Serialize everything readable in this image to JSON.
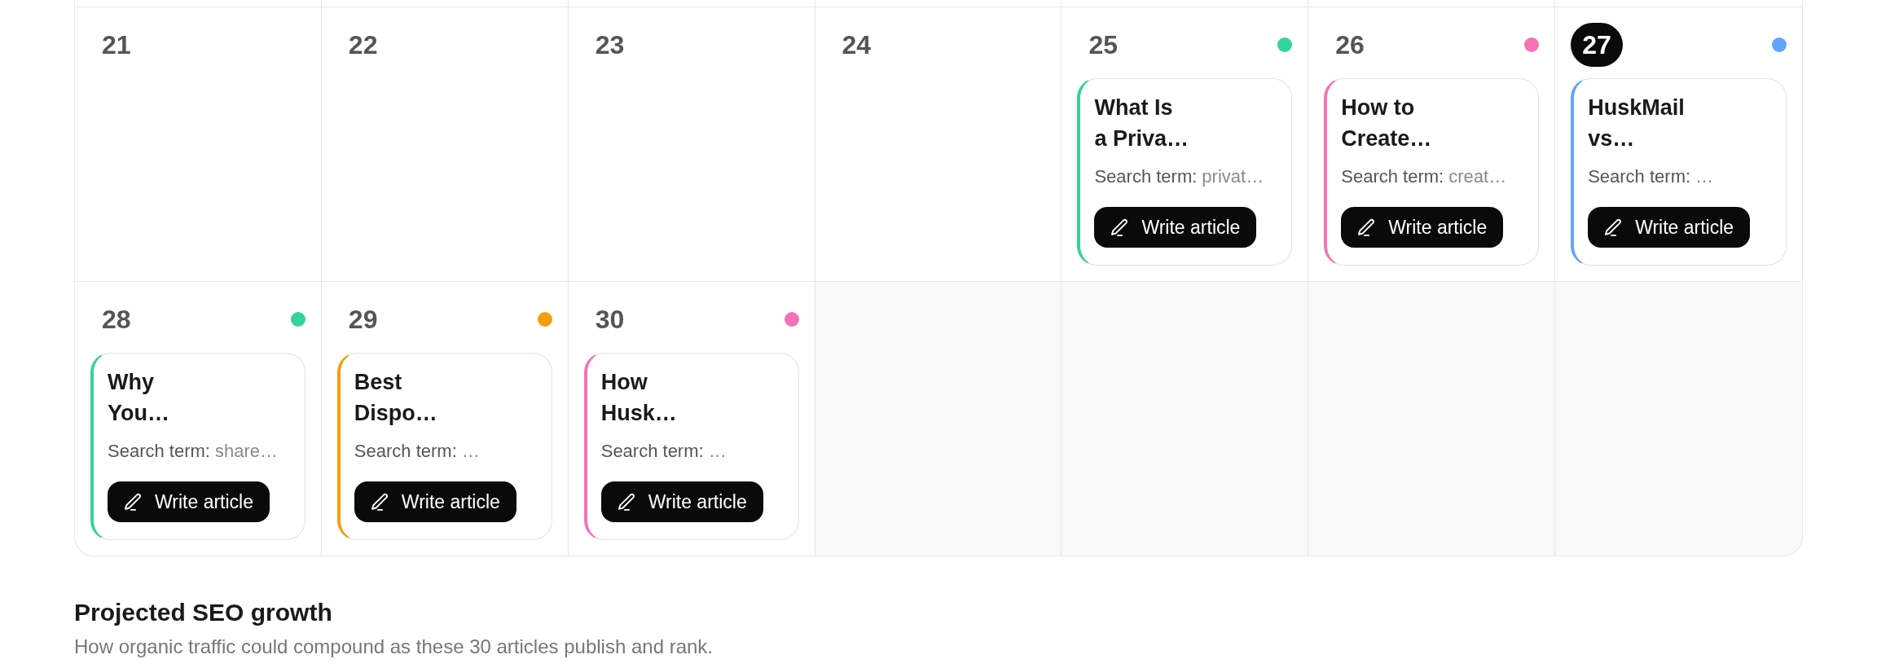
{
  "calendar": {
    "weeks": [
      {
        "days": [
          {
            "kind": "day",
            "number": "21",
            "today": false
          },
          {
            "kind": "day",
            "number": "22",
            "today": false
          },
          {
            "kind": "day",
            "number": "23",
            "today": false
          },
          {
            "kind": "day",
            "number": "24",
            "today": false
          },
          {
            "kind": "day",
            "number": "25",
            "today": false,
            "color": "#34d399",
            "article": {
              "title": "What Is\na Priva…",
              "search_label": "Search term:",
              "search_term": "privat…",
              "button": "Write article"
            }
          },
          {
            "kind": "day",
            "number": "26",
            "today": false,
            "color": "#f472b6",
            "article": {
              "title": "How to\nCreate…",
              "search_label": "Search term:",
              "search_term": "creat…",
              "button": "Write article"
            }
          },
          {
            "kind": "day",
            "number": "27",
            "today": true,
            "color": "#60a5fa",
            "article": {
              "title": "HuskMail\nvs…",
              "search_label": "Search term:",
              "search_term": "…",
              "button": "Write article"
            }
          }
        ]
      },
      {
        "days": [
          {
            "kind": "day",
            "number": "28",
            "today": false,
            "color": "#34d399",
            "article": {
              "title": "Why\nYou…",
              "search_label": "Search term:",
              "search_term": "share…",
              "button": "Write article"
            }
          },
          {
            "kind": "day",
            "number": "29",
            "today": false,
            "color": "#f59e0b",
            "article": {
              "title": "Best\nDispo…",
              "search_label": "Search term:",
              "search_term": "…",
              "button": "Write article"
            }
          },
          {
            "kind": "day",
            "number": "30",
            "today": false,
            "color": "#f472b6",
            "article": {
              "title": "How\nHusk…",
              "search_label": "Search term:",
              "search_term": "…",
              "button": "Write article"
            }
          },
          {
            "kind": "empty"
          },
          {
            "kind": "empty"
          },
          {
            "kind": "empty"
          },
          {
            "kind": "empty"
          }
        ]
      }
    ]
  },
  "seo_section": {
    "title": "Projected SEO growth",
    "subtitle": "How organic traffic could compound as these 30 articles publish and rank."
  }
}
